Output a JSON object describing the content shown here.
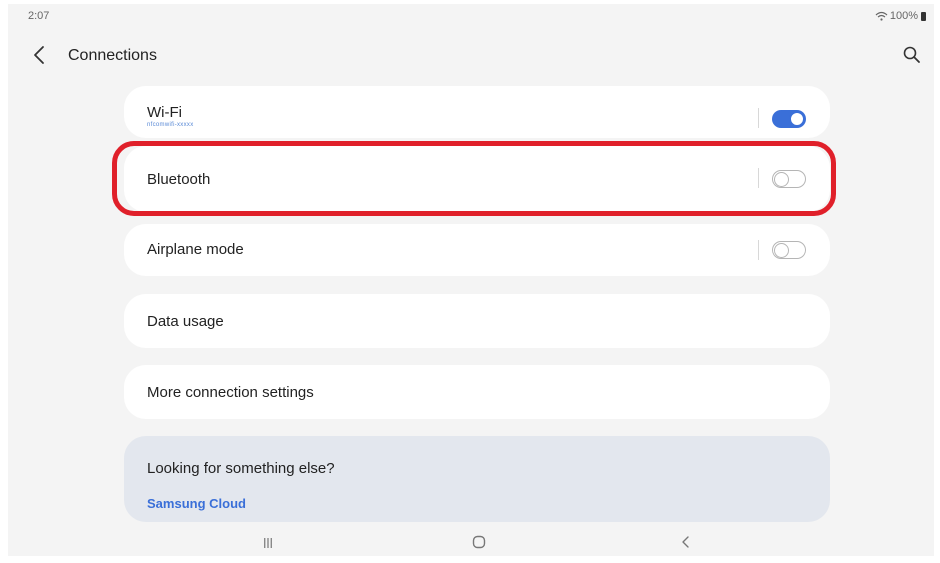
{
  "status_bar": {
    "time": "2:07",
    "battery": "100%",
    "icons": [
      "wifi-icon",
      "battery-icon"
    ]
  },
  "header": {
    "title": "Connections",
    "icons": [
      "back-arrow-icon",
      "search-icon"
    ]
  },
  "settings": [
    {
      "label": "Wi-Fi",
      "sublabel": "nfcomwifi-xxxxx",
      "toggle": "on"
    },
    {
      "label": "Bluetooth",
      "toggle": "off",
      "highlighted": true
    },
    {
      "label": "Airplane mode",
      "toggle": "off"
    },
    {
      "label": "Data usage"
    },
    {
      "label": "More connection settings"
    }
  ],
  "suggestion": {
    "title": "Looking for something else?",
    "link": "Samsung Cloud"
  },
  "navigation_bar": {
    "icons": [
      "recent-apps-icon",
      "home-icon",
      "back-icon"
    ]
  },
  "colors": {
    "accent": "#3a6fd8",
    "highlight": "#e0202a",
    "background": "#f4f4f4",
    "suggestion_background": "#e3e7ee"
  }
}
